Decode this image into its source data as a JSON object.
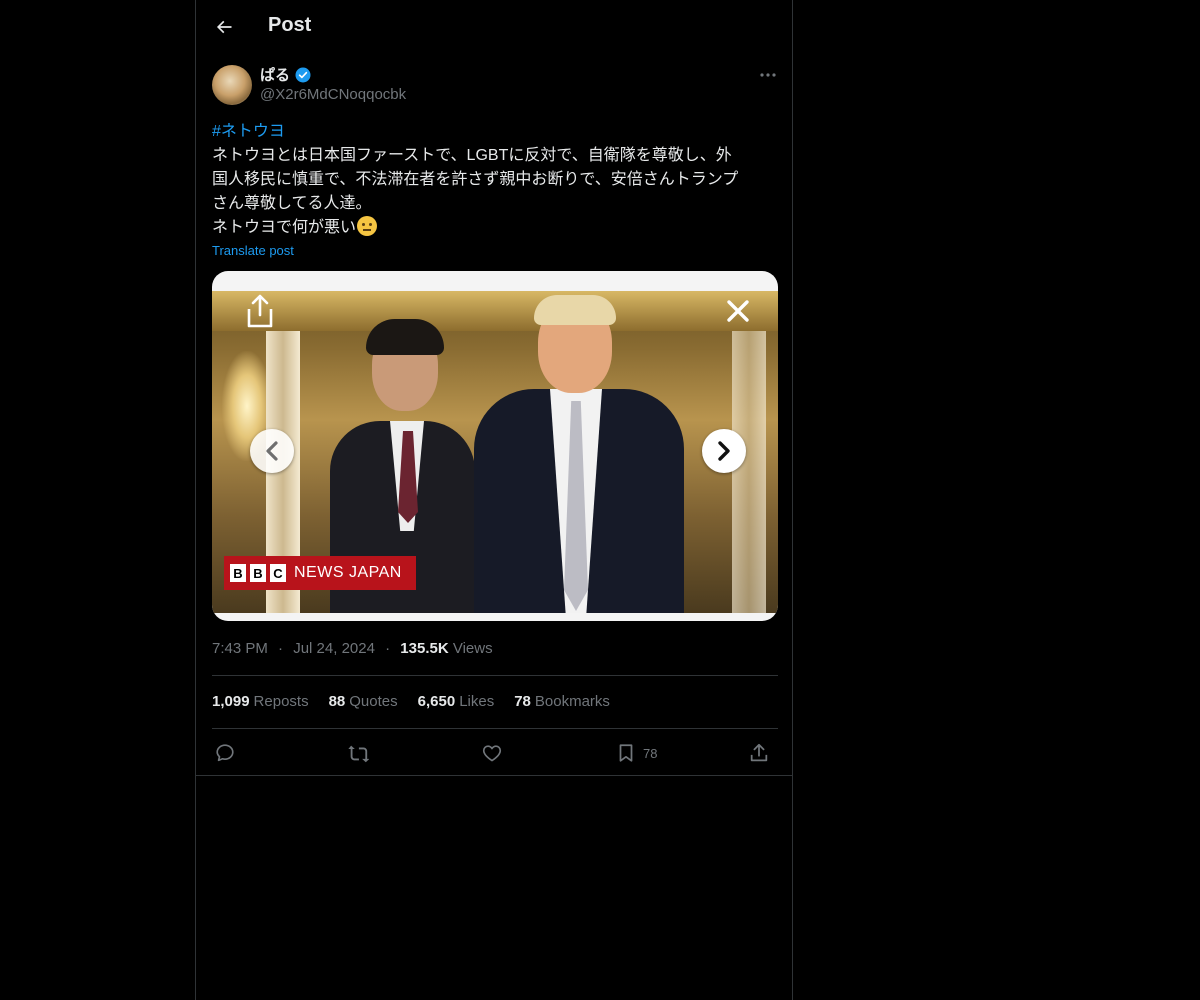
{
  "header": {
    "title": "Post"
  },
  "author": {
    "display_name": "ぱる",
    "handle": "@X2r6MdCNoqqocbk",
    "verified": true
  },
  "post": {
    "hashtag": "#ネトウヨ",
    "lines": [
      "ネトウヨとは日本国ファーストで、LGBTに反対で、自衛隊を尊敬し、外",
      "国人移民に慎重で、不法滞在者を許さず親中お断りで、安倍さんトランプ",
      "さん尊敬してる人達。",
      "ネトウヨで何が悪い"
    ],
    "translate_label": "Translate post"
  },
  "media": {
    "watermark_bbc": [
      "B",
      "B",
      "C"
    ],
    "watermark_text": "NEWS JAPAN"
  },
  "meta": {
    "time": "7:43 PM",
    "sep1": "·",
    "date": "Jul 24, 2024",
    "sep2": "·",
    "views_count": "135.5K",
    "views_label": "Views"
  },
  "stats": [
    {
      "count": "1,099",
      "label": "Reposts"
    },
    {
      "count": "88",
      "label": "Quotes"
    },
    {
      "count": "6,650",
      "label": "Likes"
    },
    {
      "count": "78",
      "label": "Bookmarks"
    }
  ],
  "actions": {
    "bookmark_count": "78"
  },
  "colors": {
    "accent": "#1d9bf0",
    "background": "#000000",
    "text": "#e7e9ea",
    "muted": "#71767b",
    "border": "#2f3336"
  }
}
